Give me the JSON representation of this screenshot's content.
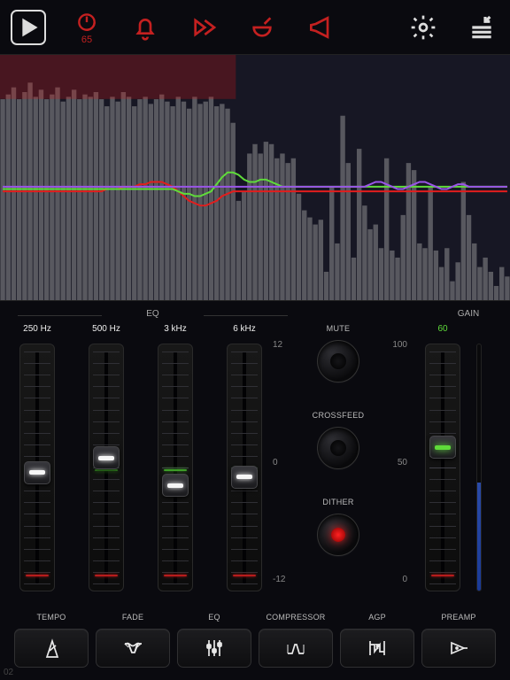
{
  "toolbar": {
    "timer_value": "65"
  },
  "spectrum": {
    "bars": [
      85,
      87,
      90,
      85,
      88,
      92,
      86,
      89,
      85,
      87,
      90,
      84,
      86,
      89,
      85,
      87,
      86,
      88,
      85,
      82,
      86,
      84,
      88,
      86,
      82,
      85,
      86,
      83,
      85,
      87,
      84,
      82,
      86,
      84,
      81,
      86,
      83,
      84,
      86,
      82,
      83,
      81,
      75,
      42,
      46,
      62,
      66,
      62,
      67,
      66,
      60,
      62,
      58,
      60,
      45,
      38,
      35,
      32,
      34,
      12,
      48,
      24,
      78,
      58,
      18,
      64,
      40,
      30,
      32,
      22,
      60,
      21,
      18,
      36,
      58,
      55,
      24,
      22,
      48,
      21,
      14,
      22,
      8,
      16,
      50,
      36,
      24,
      14,
      18,
      12,
      6,
      14,
      10
    ],
    "red_line": [
      46,
      46,
      46,
      46,
      46,
      46,
      46,
      46,
      46,
      46,
      46,
      46,
      46,
      46,
      46,
      46,
      46,
      46,
      46,
      47,
      47,
      47,
      48,
      48,
      48,
      49,
      49,
      50,
      50,
      50,
      49,
      48,
      46,
      44,
      42,
      41,
      40,
      40,
      41,
      42,
      44,
      45,
      46,
      46,
      46,
      46,
      46,
      46,
      46,
      46,
      46,
      46,
      46,
      46,
      46,
      46,
      46,
      46,
      46,
      46,
      46,
      46,
      46,
      46,
      46,
      46,
      46,
      46,
      46,
      46,
      46,
      46,
      46,
      46,
      46,
      46,
      46,
      46,
      46,
      46,
      46,
      46,
      46,
      46,
      46,
      46,
      46,
      46,
      46,
      46,
      46,
      46,
      46
    ],
    "green_line": [
      47,
      47,
      47,
      47,
      47,
      47,
      47,
      47,
      47,
      47,
      47,
      47,
      47,
      47,
      47,
      47,
      47,
      47,
      47,
      47,
      47,
      47,
      47,
      47,
      47,
      47,
      47,
      47,
      47,
      47,
      47,
      47,
      46,
      45,
      45,
      44,
      44,
      45,
      46,
      49,
      52,
      54,
      54,
      53,
      51,
      50,
      50,
      51,
      51,
      50,
      49,
      48,
      48,
      48,
      48,
      48,
      48,
      48,
      48,
      48,
      48,
      48,
      48,
      48,
      48,
      48,
      48,
      48,
      48,
      48,
      48,
      48,
      48,
      48,
      48,
      48,
      48,
      48,
      48,
      48,
      48,
      48,
      48,
      48,
      48,
      48,
      48,
      48,
      48,
      48,
      48,
      48,
      48
    ],
    "violet_line": [
      48,
      48,
      48,
      48,
      48,
      48,
      48,
      48,
      48,
      48,
      48,
      48,
      48,
      48,
      48,
      48,
      48,
      48,
      48,
      48,
      48,
      48,
      48,
      48,
      48,
      48,
      48,
      48,
      48,
      48,
      48,
      48,
      48,
      48,
      48,
      48,
      48,
      48,
      48,
      48,
      48,
      48,
      48,
      48,
      48,
      48,
      48,
      48,
      48,
      48,
      48,
      48,
      48,
      48,
      48,
      48,
      48,
      48,
      48,
      48,
      48,
      48,
      48,
      48,
      48,
      48,
      48,
      49,
      50,
      50,
      49,
      48,
      47,
      47,
      48,
      49,
      50,
      50,
      49,
      48,
      47,
      47,
      48,
      49,
      49,
      48,
      48,
      48,
      48,
      48,
      48,
      48,
      48
    ]
  },
  "eq": {
    "title": "EQ",
    "bands": [
      {
        "freq": "250 Hz",
        "value": 0.48
      },
      {
        "freq": "500 Hz",
        "value": 0.55
      },
      {
        "freq": "3 kHz",
        "value": 0.42
      },
      {
        "freq": "6 kHz",
        "value": 0.46
      }
    ],
    "scale": {
      "top": "12",
      "mid": "0",
      "bot": "-12"
    }
  },
  "knobs": {
    "mute": "MUTE",
    "crossfeed": "CROSSFEED",
    "dither": "DITHER"
  },
  "gain": {
    "title": "GAIN",
    "top": "100",
    "mid": "50",
    "bot": "0",
    "value": "60",
    "value_pct": 0.6,
    "meter_fill": 0.44
  },
  "bottom": [
    {
      "id": "tempo",
      "label": "TEMPO"
    },
    {
      "id": "fade",
      "label": "FADE"
    },
    {
      "id": "eq",
      "label": "EQ"
    },
    {
      "id": "compressor",
      "label": "COMPRESSOR"
    },
    {
      "id": "agp",
      "label": "AGP"
    },
    {
      "id": "preamp",
      "label": "PREAMP"
    }
  ],
  "footer_index": "02"
}
